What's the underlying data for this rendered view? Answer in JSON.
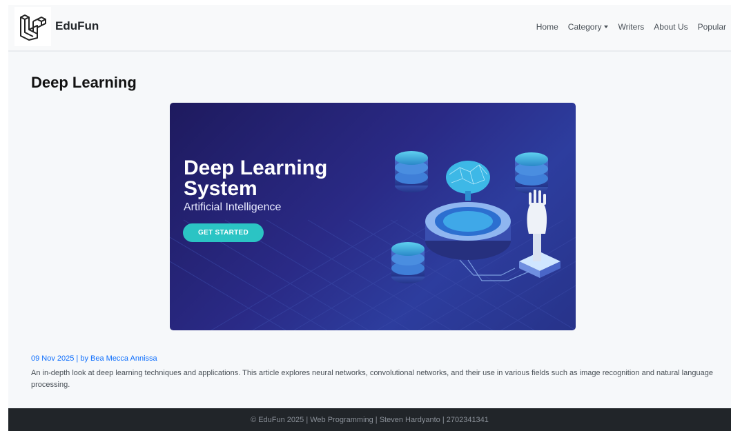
{
  "brand": {
    "name": "EduFun",
    "logo_icon": "laravel-logo-icon"
  },
  "nav": {
    "items": [
      {
        "label": "Home"
      },
      {
        "label": "Category",
        "dropdown": true
      },
      {
        "label": "Writers"
      },
      {
        "label": "About Us"
      },
      {
        "label": "Popular"
      }
    ]
  },
  "article": {
    "title": "Deep Learning",
    "banner": {
      "headline": "Deep Learning System",
      "subtitle": "Artificial Intelligence",
      "button_label": "GET STARTED"
    },
    "meta": "09 Nov 2025 | by Bea Mecca Annissa",
    "description": "An in-depth look at deep learning techniques and applications. This article explores neural networks, convolutional networks, and their use in various fields such as image recognition and natural language processing."
  },
  "footer": {
    "text": "© EduFun 2025 | Web Programming | Steven Hardyanto | 2702341341"
  },
  "colors": {
    "accent": "#0d6efd",
    "footer_bg": "#212529",
    "banner_bg": "#2a2a86",
    "cta": "#2bc4c4"
  }
}
